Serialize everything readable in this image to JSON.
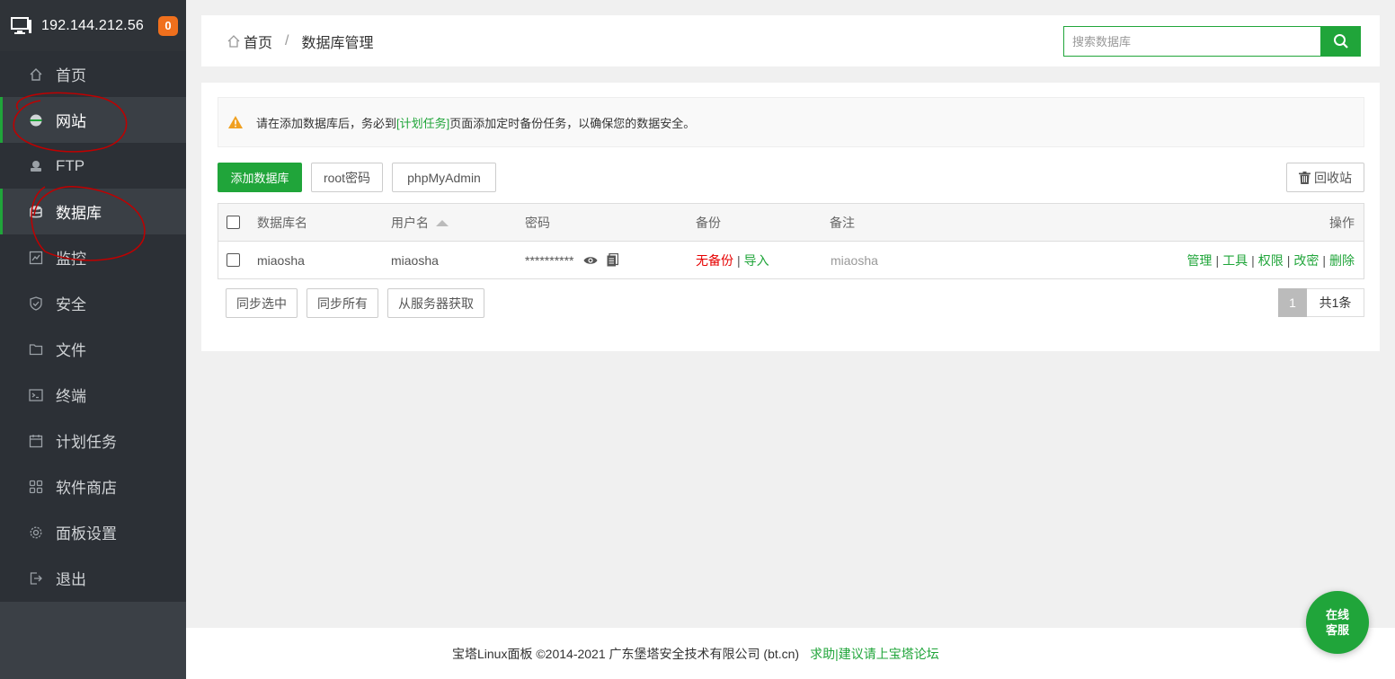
{
  "topbar": {
    "ip": "192.144.212.56",
    "badge": "0"
  },
  "sidebar": {
    "items": [
      {
        "label": "首页",
        "icon": "home-icon"
      },
      {
        "label": "网站",
        "icon": "globe-icon"
      },
      {
        "label": "FTP",
        "icon": "ftp-icon"
      },
      {
        "label": "数据库",
        "icon": "database-icon"
      },
      {
        "label": "监控",
        "icon": "monitor-icon"
      },
      {
        "label": "安全",
        "icon": "shield-icon"
      },
      {
        "label": "文件",
        "icon": "folder-icon"
      },
      {
        "label": "终端",
        "icon": "terminal-icon"
      },
      {
        "label": "计划任务",
        "icon": "calendar-icon"
      },
      {
        "label": "软件商店",
        "icon": "apps-icon"
      },
      {
        "label": "面板设置",
        "icon": "gear-icon"
      },
      {
        "label": "退出",
        "icon": "logout-icon"
      }
    ]
  },
  "header": {
    "breadcrumb_home": "首页",
    "breadcrumb_sep": "/",
    "breadcrumb_current": "数据库管理",
    "search_placeholder": "搜索数据库"
  },
  "alert": {
    "before": "请在添加数据库后，务必到",
    "link": "[计划任务]",
    "after": "页面添加定时备份任务，以确保您的数据安全。"
  },
  "toolbar": {
    "add": "添加数据库",
    "root_pwd": "root密码",
    "phpmyadmin": "phpMyAdmin",
    "recycle": "回收站"
  },
  "table": {
    "headers": {
      "name": "数据库名",
      "user": "用户名",
      "password": "密码",
      "backup": "备份",
      "note": "备注",
      "ops": "操作"
    },
    "rows": [
      {
        "name": "miaosha",
        "user": "miaosha",
        "password": "**********",
        "backup_status": "无备份",
        "backup_sep": "|",
        "import": "导入",
        "note": "miaosha",
        "ops": [
          "管理",
          "工具",
          "权限",
          "改密",
          "删除"
        ]
      }
    ]
  },
  "bottom": {
    "sync_selected": "同步选中",
    "sync_all": "同步所有",
    "fetch": "从服务器获取",
    "page": "1",
    "total": "共1条"
  },
  "footer": {
    "copyright": "宝塔Linux面板 ©2014-2021 广东堡塔安全技术有限公司 (bt.cn)",
    "link": "求助|建议请上宝塔论坛"
  },
  "service": {
    "line1": "在线",
    "line2": "客服"
  },
  "colors": {
    "accent": "#20a53a",
    "sidebar": "#2c3036",
    "danger": "#e60000"
  }
}
